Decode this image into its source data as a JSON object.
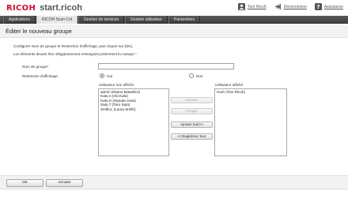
{
  "brand": {
    "logo": "RICOH",
    "site": "start.ricoh",
    "logo_color": "#c8102e"
  },
  "top_links": {
    "user": "Tom Ricoh",
    "logout": "Déconnexion",
    "help": "Assistance"
  },
  "tabs": [
    {
      "label": "Applications",
      "active": false
    },
    {
      "label": "RICOH Scan Cnt",
      "active": true
    },
    {
      "label": "Gestion de services",
      "active": false
    },
    {
      "label": "Gestion utilisateur",
      "active": false
    },
    {
      "label": "Paramètres",
      "active": false
    }
  ],
  "page_title": "Éditer le nouveau groupe",
  "instructions": {
    "line1": "Configurer Nom de groupe et Restriction d'affichage, puis cliquer sur [OK].",
    "line2": "Les éléments devant être obligatoirement renseignés présentent la marque ",
    "required_mark": "*"
  },
  "form": {
    "group_name_label": "Nom de groupe",
    "group_name_required": "*",
    "group_name_value": "",
    "display_restriction_label": "Restriction d'affichage",
    "radio_oui": "Oui",
    "radio_non": "Non",
    "selected": "Oui"
  },
  "lists": {
    "left_title": "Utilisateur non affiché",
    "left_items": [
      "admin (Kitano Masahiro)",
      "Kato,A (Aki Kato)",
      "Kato,H (Hanako Kato)",
      "Sato,T (Taro Sato)",
      "Smith,L (Laura Smith)"
    ],
    "right_title": "Utilisateur affiché",
    "right_items": [
      "ricoh (Tom Ricoh)"
    ]
  },
  "transfer_buttons": {
    "add": "Ajouter>",
    "remove": "<Suppr.",
    "add_all": "Ajouter tout>>",
    "remove_all": "<<Supprimer tout"
  },
  "footer": {
    "ok": "OK",
    "cancel": "Annuler"
  }
}
